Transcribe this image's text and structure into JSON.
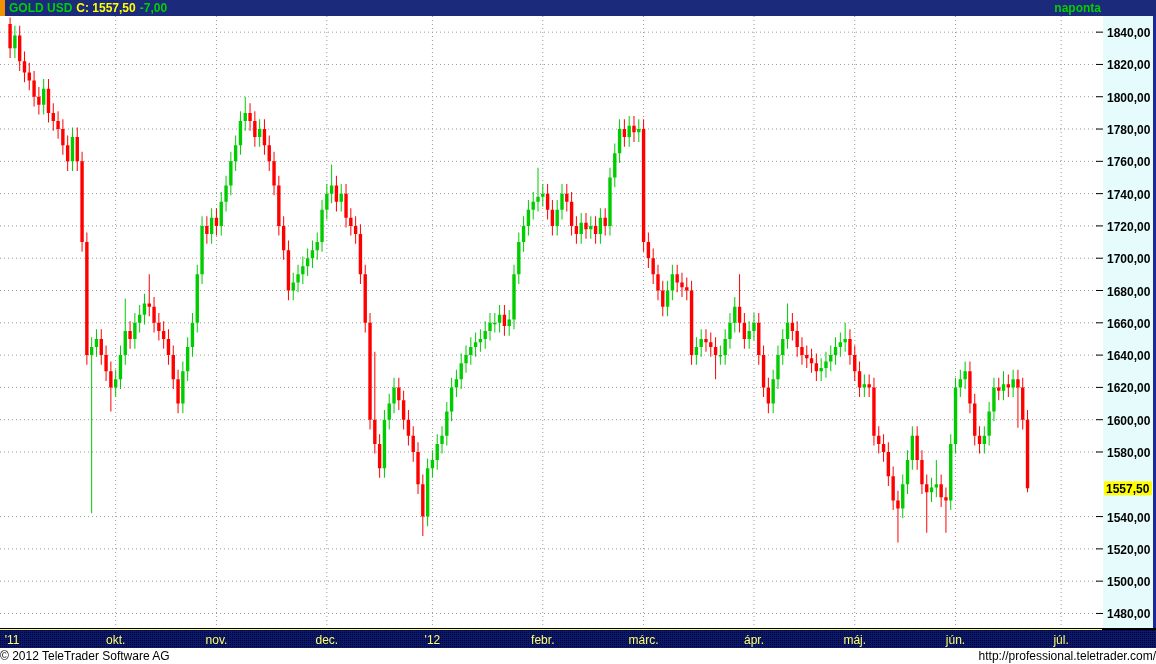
{
  "header": {
    "symbol": "GOLD USD",
    "quote": "C: 1557,50",
    "change": "-7,00",
    "period": "naponta"
  },
  "chart": {
    "last_price_label": "1557,50",
    "chart_data": {
      "type": "candlestick",
      "grid": true,
      "ylim": [
        1471,
        1850
      ],
      "yticks": [
        {
          "value": 1840,
          "label": "1840,00"
        },
        {
          "value": 1820,
          "label": "1820,00"
        },
        {
          "value": 1800,
          "label": "1800,00"
        },
        {
          "value": 1780,
          "label": "1780,00"
        },
        {
          "value": 1760,
          "label": "1760,00"
        },
        {
          "value": 1740,
          "label": "1740,00"
        },
        {
          "value": 1720,
          "label": "1720,00"
        },
        {
          "value": 1700,
          "label": "1700,00"
        },
        {
          "value": 1680,
          "label": "1680,00"
        },
        {
          "value": 1660,
          "label": "1660,00"
        },
        {
          "value": 1640,
          "label": "1640,00"
        },
        {
          "value": 1620,
          "label": "1620,00"
        },
        {
          "value": 1600,
          "label": "1600,00"
        },
        {
          "value": 1580,
          "label": "1580,00"
        },
        {
          "value": 1540,
          "label": "1540,00"
        },
        {
          "value": 1520,
          "label": "1520,00"
        },
        {
          "value": 1500,
          "label": "1500,00"
        },
        {
          "value": 1480,
          "label": "1480,00"
        }
      ],
      "categories": [
        "'11",
        null,
        null,
        null,
        null,
        null,
        null,
        null,
        null,
        null,
        null,
        null,
        null,
        null,
        null,
        null,
        null,
        null,
        null,
        null,
        null,
        null,
        "okt.",
        null,
        null,
        null,
        null,
        null,
        null,
        null,
        null,
        null,
        null,
        null,
        null,
        null,
        null,
        null,
        null,
        null,
        null,
        null,
        null,
        "nov.",
        null,
        null,
        null,
        null,
        null,
        null,
        null,
        null,
        null,
        null,
        null,
        null,
        null,
        null,
        null,
        null,
        null,
        null,
        null,
        null,
        null,
        null,
        "dec.",
        null,
        null,
        null,
        null,
        null,
        null,
        null,
        null,
        null,
        null,
        null,
        null,
        null,
        null,
        null,
        null,
        null,
        null,
        null,
        null,
        null,
        "'12",
        null,
        null,
        null,
        null,
        null,
        null,
        null,
        null,
        null,
        null,
        null,
        null,
        null,
        null,
        null,
        null,
        null,
        null,
        null,
        null,
        null,
        null,
        "febr.",
        null,
        null,
        null,
        null,
        null,
        null,
        null,
        null,
        null,
        null,
        null,
        null,
        null,
        null,
        null,
        null,
        null,
        null,
        null,
        null,
        "márc.",
        null,
        null,
        null,
        null,
        null,
        null,
        null,
        null,
        null,
        null,
        null,
        null,
        null,
        null,
        null,
        null,
        null,
        null,
        null,
        null,
        null,
        null,
        "ápr.",
        null,
        null,
        null,
        null,
        null,
        null,
        null,
        null,
        null,
        null,
        null,
        null,
        null,
        null,
        null,
        null,
        null,
        null,
        null,
        null,
        "máj.",
        null,
        null,
        null,
        null,
        null,
        null,
        null,
        null,
        null,
        null,
        null,
        null,
        null,
        null,
        null,
        null,
        null,
        null,
        null,
        null,
        "jún.",
        null,
        null,
        null,
        null,
        null,
        null,
        null,
        null,
        null,
        null,
        null,
        null,
        null,
        null,
        null,
        null,
        null,
        null,
        null,
        null,
        null,
        "júl."
      ],
      "ohlc": [
        [
          1845,
          1849,
          1824,
          1830
        ],
        [
          1830,
          1844,
          1824,
          1838
        ],
        [
          1838,
          1844,
          1816,
          1822
        ],
        [
          1822,
          1828,
          1809,
          1815
        ],
        [
          1815,
          1821,
          1804,
          1810
        ],
        [
          1810,
          1816,
          1794,
          1800
        ],
        [
          1800,
          1806,
          1789,
          1795
        ],
        [
          1795,
          1811,
          1789,
          1805
        ],
        [
          1805,
          1811,
          1784,
          1790
        ],
        [
          1790,
          1796,
          1779,
          1785
        ],
        [
          1785,
          1791,
          1774,
          1780
        ],
        [
          1780,
          1786,
          1764,
          1770
        ],
        [
          1770,
          1776,
          1754,
          1760
        ],
        [
          1760,
          1781,
          1754,
          1775
        ],
        [
          1775,
          1781,
          1754,
          1760
        ],
        [
          1760,
          1766,
          1704,
          1710
        ],
        [
          1710,
          1716,
          1634,
          1640
        ],
        [
          1640,
          1651,
          1542,
          1645
        ],
        [
          1645,
          1656,
          1639,
          1650
        ],
        [
          1650,
          1656,
          1634,
          1640
        ],
        [
          1640,
          1646,
          1624,
          1630
        ],
        [
          1630,
          1636,
          1605,
          1620
        ],
        [
          1620,
          1631,
          1614,
          1625
        ],
        [
          1625,
          1646,
          1619,
          1640
        ],
        [
          1640,
          1675,
          1634,
          1655
        ],
        [
          1655,
          1661,
          1644,
          1650
        ],
        [
          1650,
          1666,
          1644,
          1660
        ],
        [
          1660,
          1671,
          1654,
          1665
        ],
        [
          1665,
          1678,
          1659,
          1672
        ],
        [
          1672,
          1690,
          1664,
          1670
        ],
        [
          1670,
          1676,
          1654,
          1660
        ],
        [
          1660,
          1666,
          1649,
          1655
        ],
        [
          1655,
          1661,
          1644,
          1650
        ],
        [
          1650,
          1656,
          1634,
          1640
        ],
        [
          1640,
          1646,
          1619,
          1625
        ],
        [
          1625,
          1631,
          1604,
          1610
        ],
        [
          1610,
          1636,
          1604,
          1630
        ],
        [
          1630,
          1651,
          1624,
          1645
        ],
        [
          1645,
          1666,
          1639,
          1660
        ],
        [
          1660,
          1696,
          1654,
          1690
        ],
        [
          1690,
          1726,
          1684,
          1720
        ],
        [
          1720,
          1726,
          1709,
          1715
        ],
        [
          1715,
          1731,
          1709,
          1725
        ],
        [
          1725,
          1731,
          1714,
          1720
        ],
        [
          1720,
          1741,
          1714,
          1735
        ],
        [
          1735,
          1751,
          1729,
          1745
        ],
        [
          1745,
          1766,
          1739,
          1760
        ],
        [
          1760,
          1776,
          1754,
          1770
        ],
        [
          1770,
          1791,
          1764,
          1785
        ],
        [
          1785,
          1800,
          1779,
          1790
        ],
        [
          1790,
          1796,
          1779,
          1785
        ],
        [
          1785,
          1791,
          1769,
          1775
        ],
        [
          1775,
          1786,
          1769,
          1780
        ],
        [
          1780,
          1786,
          1764,
          1770
        ],
        [
          1770,
          1776,
          1754,
          1760
        ],
        [
          1760,
          1766,
          1739,
          1745
        ],
        [
          1745,
          1751,
          1714,
          1720
        ],
        [
          1720,
          1726,
          1699,
          1705
        ],
        [
          1705,
          1711,
          1674,
          1680
        ],
        [
          1680,
          1691,
          1674,
          1685
        ],
        [
          1685,
          1696,
          1679,
          1690
        ],
        [
          1690,
          1701,
          1684,
          1695
        ],
        [
          1695,
          1706,
          1689,
          1700
        ],
        [
          1700,
          1711,
          1694,
          1705
        ],
        [
          1705,
          1716,
          1699,
          1710
        ],
        [
          1710,
          1736,
          1704,
          1730
        ],
        [
          1730,
          1746,
          1724,
          1740
        ],
        [
          1740,
          1758,
          1734,
          1745
        ],
        [
          1745,
          1751,
          1729,
          1735
        ],
        [
          1735,
          1746,
          1729,
          1740
        ],
        [
          1740,
          1746,
          1719,
          1725
        ],
        [
          1725,
          1731,
          1714,
          1720
        ],
        [
          1720,
          1726,
          1709,
          1715
        ],
        [
          1715,
          1721,
          1684,
          1690
        ],
        [
          1690,
          1696,
          1654,
          1660
        ],
        [
          1660,
          1666,
          1594,
          1600
        ],
        [
          1600,
          1642,
          1579,
          1585
        ],
        [
          1585,
          1591,
          1564,
          1570
        ],
        [
          1570,
          1606,
          1564,
          1600
        ],
        [
          1600,
          1616,
          1594,
          1610
        ],
        [
          1610,
          1626,
          1604,
          1620
        ],
        [
          1620,
          1626,
          1606,
          1612
        ],
        [
          1612,
          1618,
          1594,
          1600
        ],
        [
          1600,
          1606,
          1584,
          1590
        ],
        [
          1590,
          1596,
          1574,
          1580
        ],
        [
          1580,
          1586,
          1554,
          1560
        ],
        [
          1560,
          1566,
          1528,
          1540
        ],
        [
          1540,
          1576,
          1534,
          1570
        ],
        [
          1570,
          1581,
          1564,
          1575
        ],
        [
          1575,
          1591,
          1569,
          1585
        ],
        [
          1585,
          1596,
          1579,
          1590
        ],
        [
          1590,
          1611,
          1584,
          1605
        ],
        [
          1605,
          1626,
          1599,
          1620
        ],
        [
          1620,
          1631,
          1614,
          1625
        ],
        [
          1625,
          1641,
          1619,
          1635
        ],
        [
          1635,
          1646,
          1629,
          1640
        ],
        [
          1640,
          1651,
          1634,
          1645
        ],
        [
          1645,
          1654,
          1639,
          1648
        ],
        [
          1648,
          1656,
          1642,
          1650
        ],
        [
          1650,
          1661,
          1644,
          1655
        ],
        [
          1655,
          1666,
          1649,
          1660
        ],
        [
          1660,
          1666,
          1654,
          1660
        ],
        [
          1660,
          1671,
          1654,
          1665
        ],
        [
          1665,
          1671,
          1652,
          1658
        ],
        [
          1658,
          1668,
          1652,
          1662
        ],
        [
          1662,
          1696,
          1656,
          1690
        ],
        [
          1690,
          1716,
          1684,
          1710
        ],
        [
          1710,
          1726,
          1704,
          1720
        ],
        [
          1720,
          1736,
          1714,
          1730
        ],
        [
          1730,
          1741,
          1724,
          1735
        ],
        [
          1735,
          1756,
          1729,
          1738
        ],
        [
          1738,
          1746,
          1732,
          1740
        ],
        [
          1740,
          1746,
          1724,
          1730
        ],
        [
          1730,
          1736,
          1714,
          1720
        ],
        [
          1720,
          1736,
          1714,
          1730
        ],
        [
          1730,
          1746,
          1724,
          1740
        ],
        [
          1740,
          1746,
          1729,
          1735
        ],
        [
          1735,
          1741,
          1714,
          1720
        ],
        [
          1720,
          1726,
          1709,
          1715
        ],
        [
          1715,
          1728,
          1709,
          1722
        ],
        [
          1722,
          1728,
          1712,
          1718
        ],
        [
          1718,
          1726,
          1712,
          1720
        ],
        [
          1720,
          1726,
          1709,
          1715
        ],
        [
          1715,
          1731,
          1709,
          1725
        ],
        [
          1725,
          1731,
          1714,
          1720
        ],
        [
          1720,
          1756,
          1714,
          1750
        ],
        [
          1750,
          1771,
          1744,
          1765
        ],
        [
          1765,
          1786,
          1759,
          1780
        ],
        [
          1780,
          1786,
          1769,
          1775
        ],
        [
          1775,
          1788,
          1769,
          1782
        ],
        [
          1782,
          1788,
          1772,
          1778
        ],
        [
          1778,
          1786,
          1772,
          1780
        ],
        [
          1780,
          1786,
          1704,
          1710
        ],
        [
          1710,
          1716,
          1694,
          1700
        ],
        [
          1700,
          1706,
          1684,
          1690
        ],
        [
          1690,
          1696,
          1674,
          1680
        ],
        [
          1680,
          1686,
          1664,
          1670
        ],
        [
          1670,
          1686,
          1664,
          1680
        ],
        [
          1680,
          1696,
          1674,
          1690
        ],
        [
          1690,
          1696,
          1679,
          1685
        ],
        [
          1685,
          1691,
          1676,
          1682
        ],
        [
          1682,
          1688,
          1674,
          1680
        ],
        [
          1680,
          1686,
          1634,
          1640
        ],
        [
          1640,
          1651,
          1634,
          1645
        ],
        [
          1645,
          1656,
          1639,
          1650
        ],
        [
          1650,
          1656,
          1642,
          1648
        ],
        [
          1648,
          1654,
          1639,
          1645
        ],
        [
          1645,
          1651,
          1625,
          1640
        ],
        [
          1640,
          1646,
          1634,
          1640
        ],
        [
          1640,
          1656,
          1634,
          1650
        ],
        [
          1650,
          1666,
          1644,
          1660
        ],
        [
          1660,
          1676,
          1654,
          1670
        ],
        [
          1670,
          1690,
          1654,
          1660
        ],
        [
          1660,
          1666,
          1644,
          1650
        ],
        [
          1650,
          1661,
          1644,
          1655
        ],
        [
          1655,
          1666,
          1649,
          1660
        ],
        [
          1660,
          1666,
          1634,
          1640
        ],
        [
          1640,
          1646,
          1614,
          1620
        ],
        [
          1620,
          1626,
          1604,
          1610
        ],
        [
          1610,
          1631,
          1604,
          1625
        ],
        [
          1625,
          1646,
          1619,
          1640
        ],
        [
          1640,
          1656,
          1634,
          1650
        ],
        [
          1650,
          1672,
          1644,
          1660
        ],
        [
          1660,
          1666,
          1649,
          1655
        ],
        [
          1655,
          1661,
          1639,
          1645
        ],
        [
          1645,
          1651,
          1634,
          1640
        ],
        [
          1640,
          1646,
          1632,
          1638
        ],
        [
          1638,
          1644,
          1629,
          1635
        ],
        [
          1635,
          1641,
          1624,
          1630
        ],
        [
          1630,
          1638,
          1624,
          1632
        ],
        [
          1632,
          1642,
          1626,
          1636
        ],
        [
          1636,
          1646,
          1630,
          1640
        ],
        [
          1640,
          1651,
          1634,
          1645
        ],
        [
          1645,
          1654,
          1639,
          1648
        ],
        [
          1648,
          1660,
          1642,
          1650
        ],
        [
          1650,
          1656,
          1634,
          1640
        ],
        [
          1640,
          1646,
          1624,
          1630
        ],
        [
          1630,
          1636,
          1614,
          1620
        ],
        [
          1620,
          1628,
          1614,
          1622
        ],
        [
          1622,
          1628,
          1614,
          1620
        ],
        [
          1620,
          1626,
          1584,
          1590
        ],
        [
          1590,
          1596,
          1579,
          1585
        ],
        [
          1585,
          1591,
          1574,
          1580
        ],
        [
          1580,
          1586,
          1559,
          1565
        ],
        [
          1565,
          1571,
          1544,
          1550
        ],
        [
          1550,
          1556,
          1524,
          1545
        ],
        [
          1545,
          1566,
          1539,
          1560
        ],
        [
          1560,
          1581,
          1554,
          1575
        ],
        [
          1575,
          1596,
          1569,
          1590
        ],
        [
          1590,
          1596,
          1569,
          1575
        ],
        [
          1575,
          1581,
          1554,
          1560
        ],
        [
          1560,
          1566,
          1530,
          1555
        ],
        [
          1555,
          1564,
          1549,
          1558
        ],
        [
          1558,
          1575,
          1552,
          1560
        ],
        [
          1560,
          1566,
          1546,
          1552
        ],
        [
          1552,
          1558,
          1530,
          1550
        ],
        [
          1550,
          1591,
          1544,
          1585
        ],
        [
          1585,
          1626,
          1579,
          1620
        ],
        [
          1620,
          1631,
          1614,
          1625
        ],
        [
          1625,
          1636,
          1619,
          1630
        ],
        [
          1630,
          1636,
          1604,
          1610
        ],
        [
          1610,
          1616,
          1584,
          1590
        ],
        [
          1590,
          1596,
          1579,
          1585
        ],
        [
          1585,
          1596,
          1579,
          1590
        ],
        [
          1590,
          1611,
          1584,
          1605
        ],
        [
          1605,
          1626,
          1599,
          1620
        ],
        [
          1620,
          1626,
          1612,
          1618
        ],
        [
          1618,
          1630,
          1612,
          1622
        ],
        [
          1622,
          1628,
          1614,
          1620
        ],
        [
          1620,
          1631,
          1614,
          1625
        ],
        [
          1625,
          1631,
          1595,
          1620
        ],
        [
          1620,
          1626,
          1594,
          1600
        ],
        [
          1600,
          1606,
          1555,
          1557.5
        ],
        null,
        null,
        null,
        null,
        null,
        null,
        null
      ]
    }
  },
  "footer": {
    "copyright": "© 2012 TeleTrader Software AG",
    "url": "http://professional.teletrader.com/"
  }
}
